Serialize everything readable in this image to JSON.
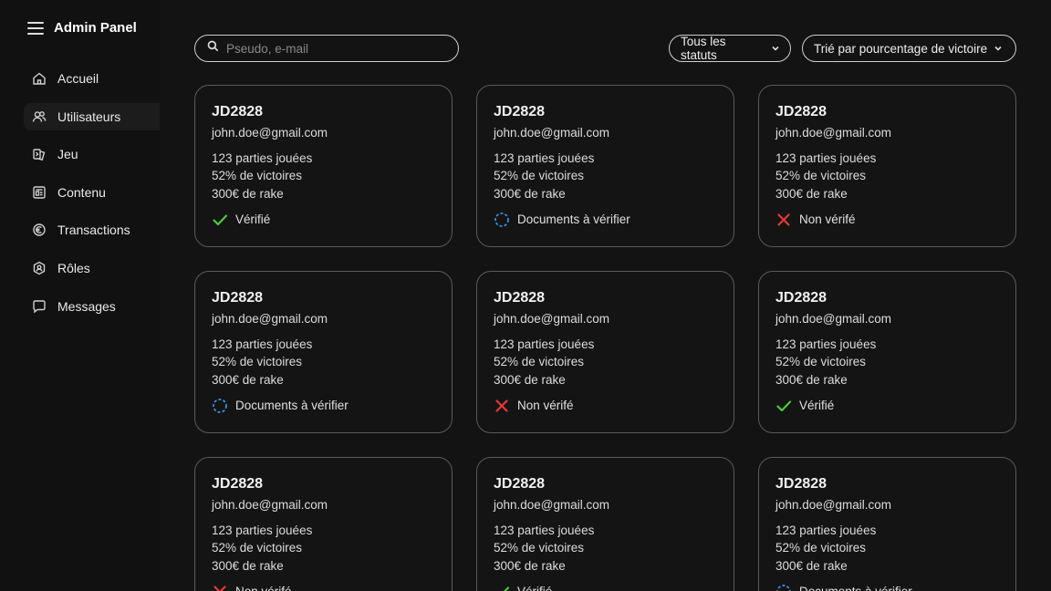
{
  "app": {
    "title": "Admin Panel"
  },
  "sidebar": {
    "items": [
      {
        "label": "Accueil",
        "icon": "home-icon",
        "active": false
      },
      {
        "label": "Utilisateurs",
        "icon": "users-icon",
        "active": true
      },
      {
        "label": "Jeu",
        "icon": "game-icon",
        "active": false
      },
      {
        "label": "Contenu",
        "icon": "content-icon",
        "active": false
      },
      {
        "label": "Transactions",
        "icon": "transactions-icon",
        "active": false
      },
      {
        "label": "Rôles",
        "icon": "roles-icon",
        "active": false
      },
      {
        "label": "Messages",
        "icon": "messages-icon",
        "active": false
      }
    ]
  },
  "search": {
    "placeholder": "Pseudo, e-mail",
    "value": ""
  },
  "filters": {
    "status_label": "Tous les statuts",
    "sort_label": "Trié par pourcentage de victoire"
  },
  "colors": {
    "verified": "#4ccb3a",
    "pending": "#3a8fe0",
    "rejected": "#e53935"
  },
  "users": [
    {
      "pseudo": "JD2828",
      "email": "john.doe@gmail.com",
      "games": "123 parties jouées",
      "wins": "52% de victoires",
      "rake": "300€ de rake",
      "status": "verified",
      "status_label": "Vérifié"
    },
    {
      "pseudo": "JD2828",
      "email": "john.doe@gmail.com",
      "games": "123 parties jouées",
      "wins": "52% de victoires",
      "rake": "300€ de rake",
      "status": "pending",
      "status_label": "Documents à vérifier"
    },
    {
      "pseudo": "JD2828",
      "email": "john.doe@gmail.com",
      "games": "123 parties jouées",
      "wins": "52% de victoires",
      "rake": "300€ de rake",
      "status": "rejected",
      "status_label": "Non vérifé"
    },
    {
      "pseudo": "JD2828",
      "email": "john.doe@gmail.com",
      "games": "123 parties jouées",
      "wins": "52% de victoires",
      "rake": "300€ de rake",
      "status": "pending",
      "status_label": "Documents à vérifier"
    },
    {
      "pseudo": "JD2828",
      "email": "john.doe@gmail.com",
      "games": "123 parties jouées",
      "wins": "52% de victoires",
      "rake": "300€ de rake",
      "status": "rejected",
      "status_label": "Non vérifé"
    },
    {
      "pseudo": "JD2828",
      "email": "john.doe@gmail.com",
      "games": "123 parties jouées",
      "wins": "52% de victoires",
      "rake": "300€ de rake",
      "status": "verified",
      "status_label": "Vérifié"
    },
    {
      "pseudo": "JD2828",
      "email": "john.doe@gmail.com",
      "games": "123 parties jouées",
      "wins": "52% de victoires",
      "rake": "300€ de rake",
      "status": "rejected",
      "status_label": "Non vérifé"
    },
    {
      "pseudo": "JD2828",
      "email": "john.doe@gmail.com",
      "games": "123 parties jouées",
      "wins": "52% de victoires",
      "rake": "300€ de rake",
      "status": "verified",
      "status_label": "Vérifié"
    },
    {
      "pseudo": "JD2828",
      "email": "john.doe@gmail.com",
      "games": "123 parties jouées",
      "wins": "52% de victoires",
      "rake": "300€ de rake",
      "status": "pending",
      "status_label": "Documents à vérifier"
    }
  ]
}
